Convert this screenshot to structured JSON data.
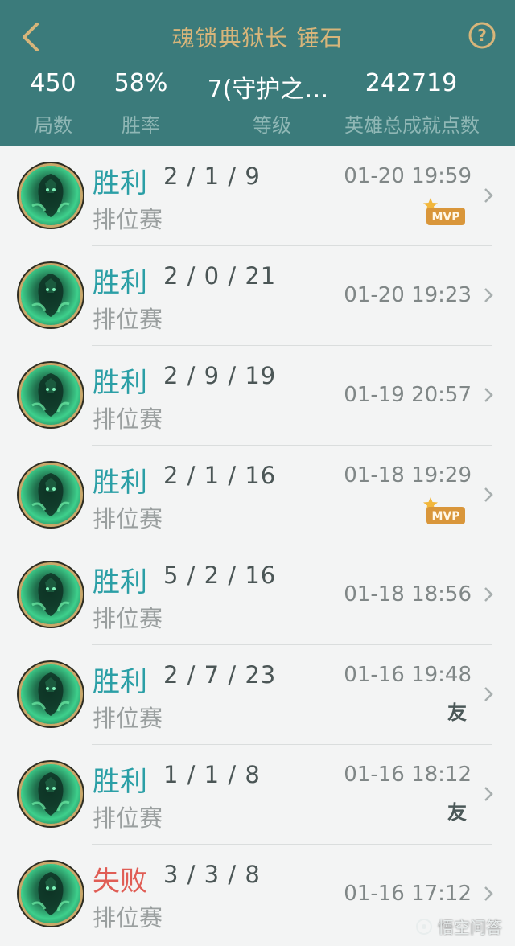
{
  "header": {
    "title": "魂锁典狱长 锤石",
    "colors": {
      "bg": "#3b7b7b",
      "title": "#d7b57a"
    }
  },
  "stats": [
    {
      "value": "450",
      "label": "局数"
    },
    {
      "value": "58%",
      "label": "胜率"
    },
    {
      "value": "7(守护之…",
      "label": "等级"
    },
    {
      "value": "242719",
      "label": "英雄总成就点数"
    }
  ],
  "matches": [
    {
      "result": "胜利",
      "outcome": "win",
      "kda": "2 / 1 / 9",
      "mode": "排位赛",
      "time": "01-20 19:59",
      "badge": "MVP"
    },
    {
      "result": "胜利",
      "outcome": "win",
      "kda": "2 / 0 / 21",
      "mode": "排位赛",
      "time": "01-20 19:23",
      "badge": ""
    },
    {
      "result": "胜利",
      "outcome": "win",
      "kda": "2 / 9 / 19",
      "mode": "排位赛",
      "time": "01-19 20:57",
      "badge": ""
    },
    {
      "result": "胜利",
      "outcome": "win",
      "kda": "2 / 1 / 16",
      "mode": "排位赛",
      "time": "01-18 19:29",
      "badge": "MVP"
    },
    {
      "result": "胜利",
      "outcome": "win",
      "kda": "5 / 2 / 16",
      "mode": "排位赛",
      "time": "01-18 18:56",
      "badge": ""
    },
    {
      "result": "胜利",
      "outcome": "win",
      "kda": "2 / 7 / 23",
      "mode": "排位赛",
      "time": "01-16 19:48",
      "badge": "友"
    },
    {
      "result": "胜利",
      "outcome": "win",
      "kda": "1 / 1 / 8",
      "mode": "排位赛",
      "time": "01-16 18:12",
      "badge": "友"
    },
    {
      "result": "失败",
      "outcome": "loss",
      "kda": "3 / 3 / 8",
      "mode": "排位赛",
      "time": "01-16 17:12",
      "badge": ""
    }
  ],
  "watermark": "悟空问答",
  "icons": [
    "back-arrow-icon",
    "help-icon",
    "chevron-right-icon",
    "mvp-badge-icon",
    "champion-avatar-icon"
  ]
}
